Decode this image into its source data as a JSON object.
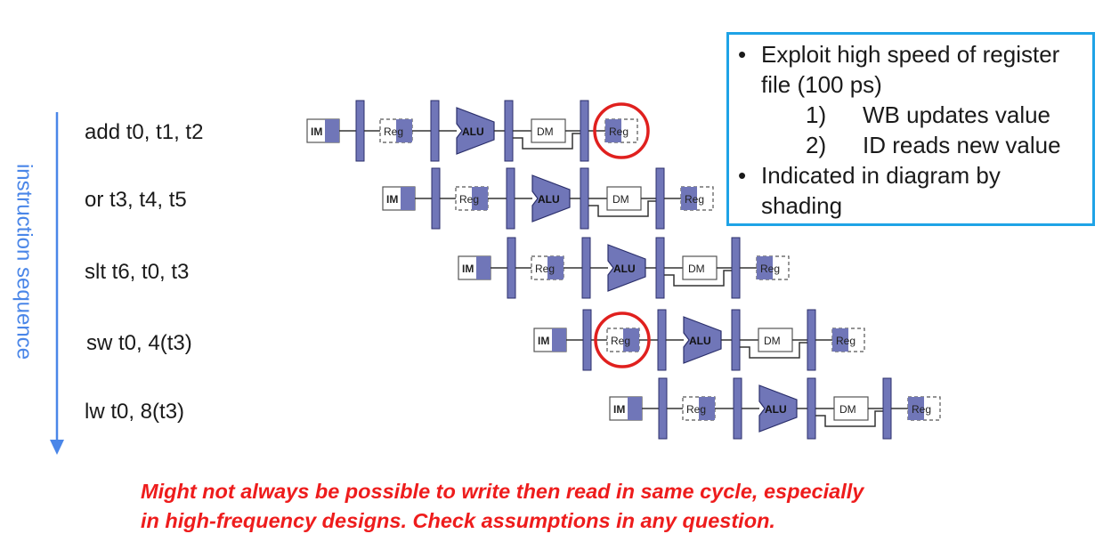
{
  "axis_label": "instruction sequence",
  "instructions": [
    "add t0, t1, t2",
    "or t3, t4, t5",
    "slt t6, t0, t3",
    "sw t0, 4(t3)",
    "lw t0, 8(t3)"
  ],
  "stage_labels": {
    "im": "IM",
    "reg": "Reg",
    "alu": "ALU",
    "dm": "DM"
  },
  "highlights": [
    {
      "instruction": 0,
      "stage": "write-back Reg"
    },
    {
      "instruction": 3,
      "stage": "decode Reg"
    }
  ],
  "info_box": {
    "bullet1": "Exploit high speed of register file (100 ps)",
    "bullet1_line1": "Exploit high speed of register",
    "bullet1_line2": "file (100 ps)",
    "sub1_num": "1)",
    "sub1_text": "WB updates value",
    "sub2_num": "2)",
    "sub2_text": "ID reads new value",
    "bullet2_line1": "Indicated in diagram by",
    "bullet2_line2": "shading"
  },
  "note": {
    "line1": "Might not always be possible to write then read in same cycle, especially",
    "line2": "in high-frequency designs. Check assumptions in any question."
  },
  "colors": {
    "stage_fill": "#7076b8",
    "stage_stroke": "#2b2f6b",
    "axis_arrow": "#4a86e8",
    "highlight": "#e0201e",
    "box_border": "#1fa3e6",
    "note_text": "#ee1c1c"
  }
}
